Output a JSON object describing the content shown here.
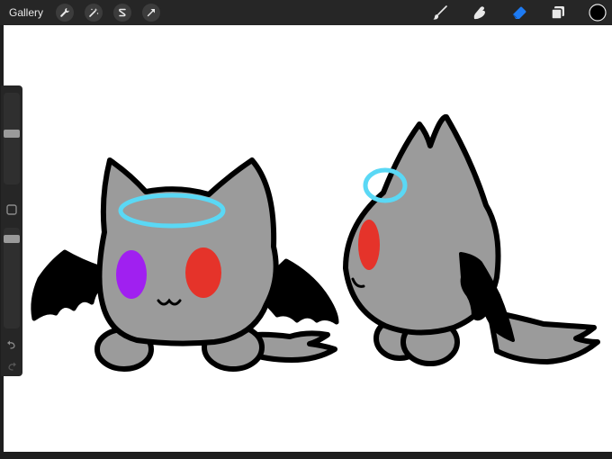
{
  "app": {
    "gallery_label": "Gallery"
  },
  "toolbar": {
    "left_tools": [
      "actions-wrench",
      "adjustments-magic-wand",
      "selection-s",
      "transform-arrow"
    ],
    "right_tools": [
      "brush",
      "smudge",
      "eraser",
      "layers",
      "color"
    ],
    "active_tool": "eraser",
    "accent_color": "#1e7bf2",
    "current_color": "#000000"
  },
  "sidebar": {
    "brush_size_level": 0.22,
    "opacity_level": 0.15,
    "buttons": [
      "modify-square",
      "undo",
      "redo"
    ]
  },
  "canvas": {
    "background": "#ffffff",
    "colors": {
      "body": "#9b9b9b",
      "outline": "#000000",
      "halo": "#5ad8f5",
      "cheek_left": "#a020f0",
      "cheek_right": "#e5332a"
    }
  }
}
